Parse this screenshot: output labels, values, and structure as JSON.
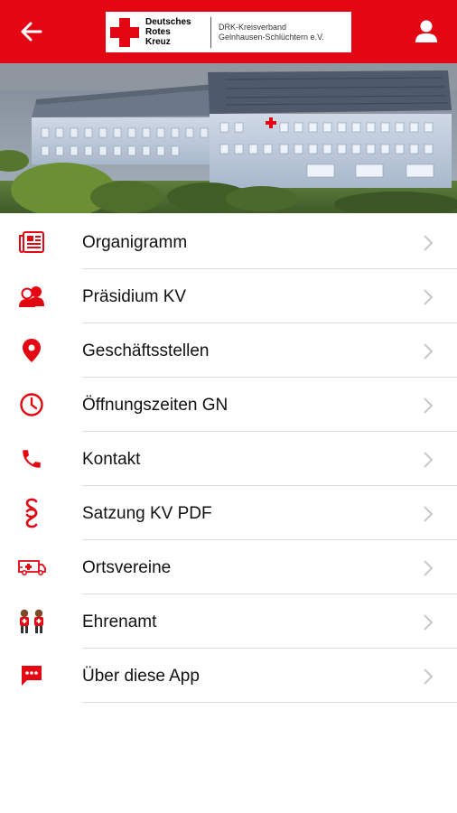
{
  "app": {
    "logo": {
      "name_line1": "Deutsches",
      "name_line2": "Rotes",
      "name_line3": "Kreuz",
      "org_line1": "DRK-Kreisverband",
      "org_line2": "Gelnhausen-Schlüchtern e.V."
    },
    "colors": {
      "brand": "#e30613",
      "text": "#111111",
      "divider": "#dcdcdc",
      "chevron": "#c8c8c8"
    },
    "header_icons": {
      "left": "arrow-left-icon",
      "right": "user-icon"
    }
  },
  "menu": {
    "items": [
      {
        "label": "Organigramm",
        "icon": "newspaper-icon"
      },
      {
        "label": "Präsidium KV",
        "icon": "people-icon"
      },
      {
        "label": "Geschäftsstellen",
        "icon": "location-pin-icon"
      },
      {
        "label": "Öffnungszeiten GN",
        "icon": "clock-icon"
      },
      {
        "label": "Kontakt",
        "icon": "phone-icon"
      },
      {
        "label": "Satzung KV PDF",
        "icon": "paragraph-icon"
      },
      {
        "label": "Ortsvereine",
        "icon": "ambulance-icon"
      },
      {
        "label": "Ehrenamt",
        "icon": "volunteers-icon"
      },
      {
        "label": "Über diese App",
        "icon": "chat-bubble-icon"
      }
    ]
  }
}
